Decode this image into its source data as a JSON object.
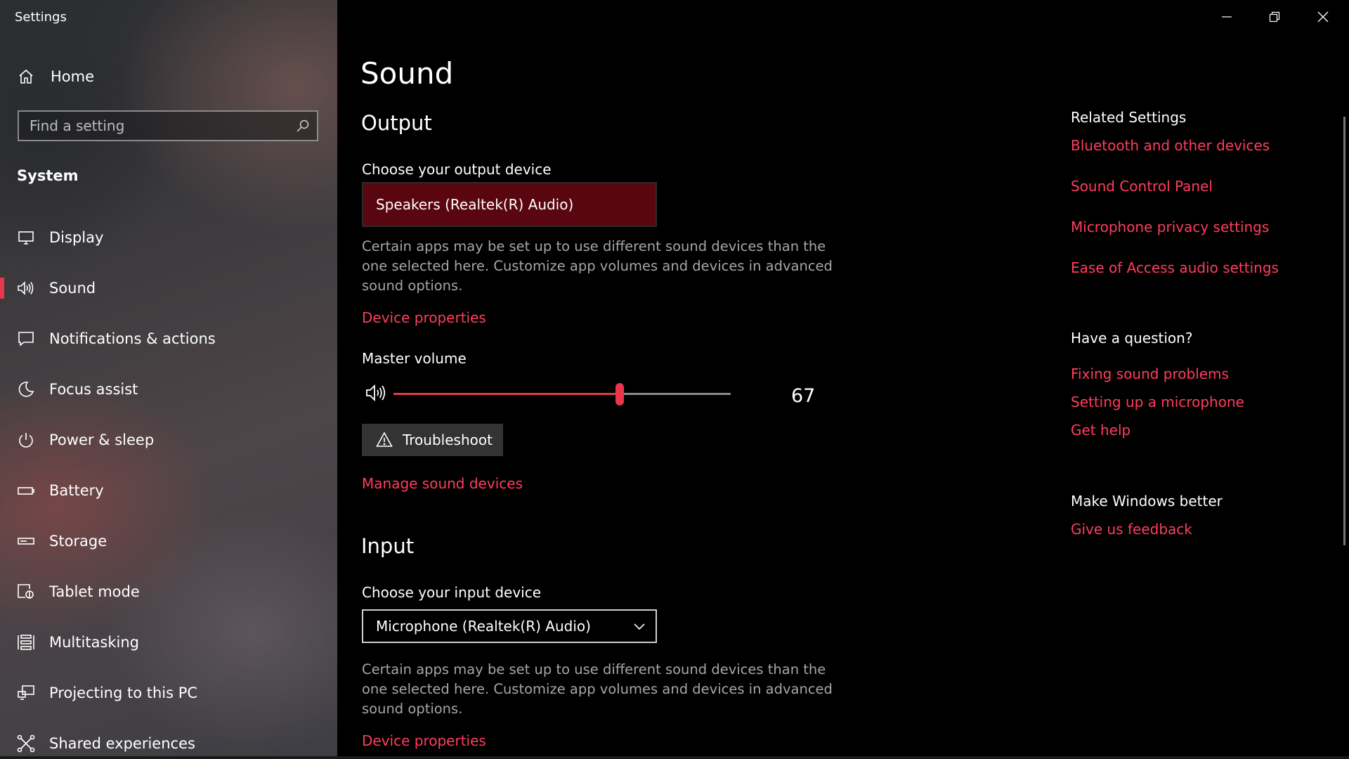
{
  "app": {
    "title": "Settings"
  },
  "sidebar": {
    "home_label": "Home",
    "search_placeholder": "Find a setting",
    "section": "System",
    "items": [
      {
        "label": "Display",
        "icon": "monitor-icon"
      },
      {
        "label": "Sound",
        "icon": "speaker-icon",
        "active": true
      },
      {
        "label": "Notifications & actions",
        "icon": "notification-icon"
      },
      {
        "label": "Focus assist",
        "icon": "moon-icon"
      },
      {
        "label": "Power & sleep",
        "icon": "power-icon"
      },
      {
        "label": "Battery",
        "icon": "battery-icon"
      },
      {
        "label": "Storage",
        "icon": "storage-icon"
      },
      {
        "label": "Tablet mode",
        "icon": "tablet-mode-icon"
      },
      {
        "label": "Multitasking",
        "icon": "multitasking-icon"
      },
      {
        "label": "Projecting to this PC",
        "icon": "projecting-icon"
      },
      {
        "label": "Shared experiences",
        "icon": "shared-experiences-icon"
      }
    ]
  },
  "main": {
    "title": "Sound",
    "output": {
      "heading": "Output",
      "device_label": "Choose your output device",
      "device_value": "Speakers (Realtek(R) Audio)",
      "description": "Certain apps may be set up to use different sound devices than the one selected here. Customize app volumes and devices in advanced sound options.",
      "device_properties": "Device properties",
      "master_volume_label": "Master volume",
      "volume": 67,
      "volume_text": "67",
      "troubleshoot": "Troubleshoot",
      "manage_devices": "Manage sound devices"
    },
    "input": {
      "heading": "Input",
      "device_label": "Choose your input device",
      "device_value": "Microphone (Realtek(R) Audio)",
      "description": "Certain apps may be set up to use different sound devices than the one selected here. Customize app volumes and devices in advanced sound options.",
      "device_properties": "Device properties"
    }
  },
  "related": {
    "heading": "Related Settings",
    "links": [
      "Bluetooth and other devices",
      "Sound Control Panel",
      "Microphone privacy settings",
      "Ease of Access audio settings"
    ],
    "question_heading": "Have a question?",
    "question_links": [
      "Fixing sound problems",
      "Setting up a microphone",
      "Get help"
    ],
    "better_heading": "Make Windows better",
    "feedback": "Give us feedback"
  },
  "colors": {
    "accent": "#e8374d",
    "link": "#ff3d5e",
    "selected_dropdown": "#5a0610"
  },
  "window_controls": [
    "minimize-icon",
    "restore-icon",
    "close-icon"
  ]
}
